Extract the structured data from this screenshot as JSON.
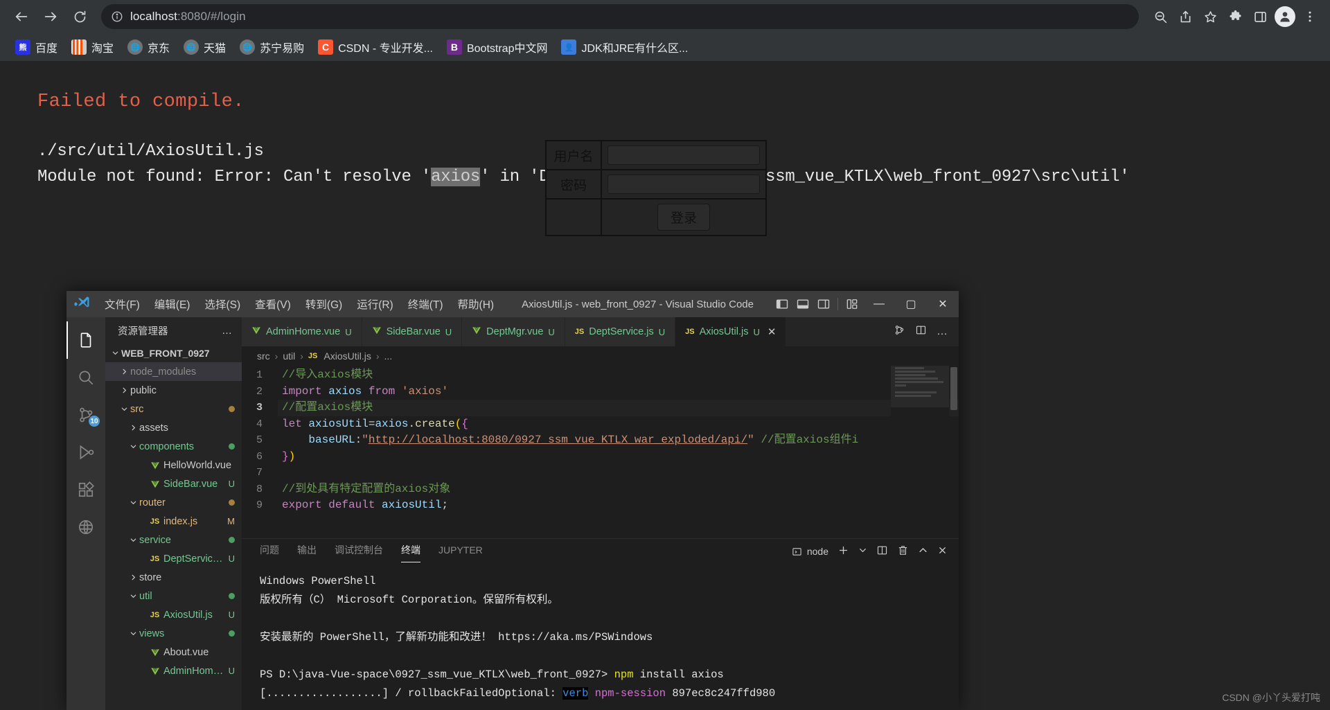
{
  "browser": {
    "back_label": "Back",
    "forward_label": "Forward",
    "reload_label": "Reload",
    "url_host": "localhost",
    "url_rest": ":8080/#/login",
    "url_full": "localhost:8080/#/login",
    "icons": {
      "info": "info-circle-icon",
      "zoom": "zoom-search-icon",
      "share": "share-icon",
      "star": "bookmark-star-icon",
      "extensions": "puzzle-extensions-icon",
      "sidepanel": "side-panel-icon",
      "profile": "profile-avatar-icon",
      "menu": "three-dot-menu-icon"
    },
    "bookmarks": [
      {
        "label": "百度",
        "icon": "baidu-icon"
      },
      {
        "label": "淘宝",
        "icon": "taobao-icon"
      },
      {
        "label": "京东",
        "icon": "jd-globe-icon"
      },
      {
        "label": "天猫",
        "icon": "tmall-globe-icon"
      },
      {
        "label": "苏宁易购",
        "icon": "suning-globe-icon"
      },
      {
        "label": "CSDN - 专业开发...",
        "icon": "csdn-icon"
      },
      {
        "label": "Bootstrap中文网",
        "icon": "bootstrap-icon"
      },
      {
        "label": "JDK和JRE有什么区...",
        "icon": "jdk-article-icon"
      }
    ]
  },
  "error_overlay": {
    "title": "Failed to compile.",
    "file": "./src/util/AxiosUtil.js",
    "message_before": "Module not found: Error: Can't resolve '",
    "highlight": "axios",
    "message_after": "' in 'D:\\java-Vue-space\\0927_ssm_vue_KTLX\\web_front_0927\\src\\util'",
    "title_color": "#e36049",
    "text_color": "#e8e8e8",
    "bg_color": "#242424"
  },
  "login_form": {
    "username_label": "用户名",
    "password_label": "密码",
    "username_value": "",
    "password_value": "",
    "submit_label": "登录"
  },
  "vscode": {
    "title": "AxiosUtil.js - web_front_0927 - Visual Studio Code",
    "menu": [
      "文件(F)",
      "编辑(E)",
      "选择(S)",
      "查看(V)",
      "转到(G)",
      "运行(R)",
      "终端(T)",
      "帮助(H)"
    ],
    "window_controls": {
      "minimize": "—",
      "maximize": "▢",
      "close": "✕"
    },
    "layout_icons": [
      "toggle-primary-sidebar-icon",
      "toggle-panel-icon",
      "toggle-secondary-sidebar-icon",
      "customize-layout-icon"
    ],
    "activity_bar": [
      {
        "name": "explorer",
        "icon": "files-explorer-icon",
        "active": true,
        "badge": ""
      },
      {
        "name": "search",
        "icon": "search-magnifier-icon",
        "active": false,
        "badge": ""
      },
      {
        "name": "source-control",
        "icon": "source-control-branch-icon",
        "active": false,
        "badge": "10"
      },
      {
        "name": "run-debug",
        "icon": "run-and-debug-icon",
        "active": false,
        "badge": ""
      },
      {
        "name": "extensions",
        "icon": "extensions-blocks-icon",
        "active": false,
        "badge": ""
      },
      {
        "name": "remote",
        "icon": "remote-explorer-icon",
        "active": false,
        "badge": ""
      }
    ],
    "explorer": {
      "title": "资源管理器",
      "more_label": "…",
      "root": "WEB_FRONT_0927",
      "tree": [
        {
          "label": "node_modules",
          "indent": 1,
          "kind": "folder",
          "state": "collapsed",
          "color": "#8c8c8c",
          "badge": "",
          "dot": "",
          "selected": true
        },
        {
          "label": "public",
          "indent": 1,
          "kind": "folder",
          "state": "collapsed",
          "color": "#cccccc",
          "badge": "",
          "dot": "",
          "selected": false
        },
        {
          "label": "src",
          "indent": 1,
          "kind": "folder",
          "state": "expanded",
          "color": "#e2b979",
          "badge": "",
          "dot": "#a5813f",
          "selected": false
        },
        {
          "label": "assets",
          "indent": 2,
          "kind": "folder",
          "state": "collapsed",
          "color": "#cccccc",
          "badge": "",
          "dot": "",
          "selected": false
        },
        {
          "label": "components",
          "indent": 2,
          "kind": "folder",
          "state": "expanded",
          "color": "#73c991",
          "badge": "",
          "dot": "#4c9e63",
          "selected": false
        },
        {
          "label": "HelloWorld.vue",
          "indent": 3,
          "kind": "vue",
          "state": "file",
          "color": "#cccccc",
          "badge": "",
          "dot": "",
          "selected": false
        },
        {
          "label": "SideBar.vue",
          "indent": 3,
          "kind": "vue",
          "state": "file",
          "color": "#73c991",
          "badge": "U",
          "dot": "",
          "selected": false
        },
        {
          "label": "router",
          "indent": 2,
          "kind": "folder",
          "state": "expanded",
          "color": "#e2b979",
          "badge": "",
          "dot": "#a5813f",
          "selected": false
        },
        {
          "label": "index.js",
          "indent": 3,
          "kind": "js",
          "state": "file",
          "color": "#e2b979",
          "badge": "M",
          "dot": "",
          "selected": false
        },
        {
          "label": "service",
          "indent": 2,
          "kind": "folder",
          "state": "expanded",
          "color": "#73c991",
          "badge": "",
          "dot": "#4c9e63",
          "selected": false
        },
        {
          "label": "DeptService.js",
          "indent": 3,
          "kind": "js",
          "state": "file",
          "color": "#73c991",
          "badge": "U",
          "dot": "",
          "selected": false
        },
        {
          "label": "store",
          "indent": 2,
          "kind": "folder",
          "state": "collapsed",
          "color": "#cccccc",
          "badge": "",
          "dot": "",
          "selected": false
        },
        {
          "label": "util",
          "indent": 2,
          "kind": "folder",
          "state": "expanded",
          "color": "#73c991",
          "badge": "",
          "dot": "#4c9e63",
          "selected": false
        },
        {
          "label": "AxiosUtil.js",
          "indent": 3,
          "kind": "js",
          "state": "file",
          "color": "#73c991",
          "badge": "U",
          "dot": "",
          "selected": false
        },
        {
          "label": "views",
          "indent": 2,
          "kind": "folder",
          "state": "expanded",
          "color": "#73c991",
          "badge": "",
          "dot": "#4c9e63",
          "selected": false
        },
        {
          "label": "About.vue",
          "indent": 3,
          "kind": "vue",
          "state": "file",
          "color": "#cccccc",
          "badge": "",
          "dot": "",
          "selected": false
        },
        {
          "label": "AdminHome.vue",
          "indent": 3,
          "kind": "vue",
          "state": "file",
          "color": "#73c991",
          "badge": "U",
          "dot": "",
          "selected": false
        }
      ]
    },
    "tabs": [
      {
        "name": "AdminHome.vue",
        "kind": "vue",
        "badge": "U",
        "active": false
      },
      {
        "name": "SideBar.vue",
        "kind": "vue",
        "badge": "U",
        "active": false
      },
      {
        "name": "DeptMgr.vue",
        "kind": "vue",
        "badge": "U",
        "active": false
      },
      {
        "name": "DeptService.js",
        "kind": "js",
        "badge": "U",
        "active": false
      },
      {
        "name": "AxiosUtil.js",
        "kind": "js",
        "badge": "U",
        "active": true
      }
    ],
    "tab_actions": [
      "split-editor-compare-icon",
      "split-editor-right-icon",
      "more-actions-icon"
    ],
    "breadcrumb": [
      "src",
      "util",
      "AxiosUtil.js",
      "..."
    ],
    "code_lines": [
      {
        "n": "1",
        "current": false,
        "tokens": [
          {
            "t": "//导入axios模块",
            "c": "c-com"
          }
        ]
      },
      {
        "n": "2",
        "current": false,
        "tokens": [
          {
            "t": "import",
            "c": "c-kw"
          },
          {
            "t": " ",
            "c": "c-op"
          },
          {
            "t": "axios",
            "c": "c-var"
          },
          {
            "t": " ",
            "c": "c-op"
          },
          {
            "t": "from",
            "c": "c-kw"
          },
          {
            "t": " ",
            "c": "c-op"
          },
          {
            "t": "'axios'",
            "c": "c-str"
          }
        ]
      },
      {
        "n": "3",
        "current": true,
        "tokens": [
          {
            "t": "//配置axios模块",
            "c": "c-com"
          }
        ]
      },
      {
        "n": "4",
        "current": false,
        "tokens": [
          {
            "t": "let",
            "c": "c-kw"
          },
          {
            "t": " ",
            "c": "c-op"
          },
          {
            "t": "axiosUtil",
            "c": "c-var"
          },
          {
            "t": "=",
            "c": "c-op"
          },
          {
            "t": "axios",
            "c": "c-var"
          },
          {
            "t": ".",
            "c": "c-op"
          },
          {
            "t": "create",
            "c": "c-fn"
          },
          {
            "t": "(",
            "c": "c-brace"
          },
          {
            "t": "{",
            "c": "c-brace2"
          }
        ]
      },
      {
        "n": "5",
        "current": false,
        "tokens": [
          {
            "t": "    ",
            "c": "c-op"
          },
          {
            "t": "baseURL",
            "c": "c-var"
          },
          {
            "t": ":",
            "c": "c-op"
          },
          {
            "t": "\"",
            "c": "c-str"
          },
          {
            "t": "http://localhost:8080/0927_ssm_vue_KTLX_war_exploded/api/",
            "c": "c-link"
          },
          {
            "t": "\"",
            "c": "c-str"
          },
          {
            "t": " ",
            "c": "c-op"
          },
          {
            "t": "//配置axios组件i",
            "c": "c-com"
          }
        ]
      },
      {
        "n": "6",
        "current": false,
        "tokens": [
          {
            "t": "}",
            "c": "c-brace2"
          },
          {
            "t": ")",
            "c": "c-brace"
          }
        ]
      },
      {
        "n": "7",
        "current": false,
        "tokens": []
      },
      {
        "n": "8",
        "current": false,
        "tokens": [
          {
            "t": "//到处具有特定配置的axios对象",
            "c": "c-com"
          }
        ]
      },
      {
        "n": "9",
        "current": false,
        "tokens": [
          {
            "t": "export",
            "c": "c-kw"
          },
          {
            "t": " ",
            "c": "c-op"
          },
          {
            "t": "default",
            "c": "c-kw"
          },
          {
            "t": " ",
            "c": "c-op"
          },
          {
            "t": "axiosUtil",
            "c": "c-var"
          },
          {
            "t": ";",
            "c": "c-op"
          }
        ]
      }
    ],
    "panel": {
      "tabs": [
        "问题",
        "输出",
        "调试控制台",
        "终端",
        "JUPYTER"
      ],
      "active_tab": "终端",
      "shell_label": "node",
      "actions": [
        "new-terminal-icon",
        "chevron-down-icon",
        "split-terminal-icon",
        "kill-terminal-trash-icon",
        "maximize-panel-icon",
        "close-panel-icon"
      ],
      "terminal_lines": [
        [
          {
            "t": "Windows PowerShell",
            "c": "t-white"
          }
        ],
        [
          {
            "t": "版权所有（C） Microsoft Corporation。保留所有权利。",
            "c": "t-white"
          }
        ],
        [
          {
            "t": "",
            "c": "t-white"
          }
        ],
        [
          {
            "t": "安装最新的 PowerShell，了解新功能和改进！ https://aka.ms/PSWindows",
            "c": "t-white"
          }
        ],
        [
          {
            "t": "",
            "c": "t-white"
          }
        ],
        [
          {
            "t": "PS D:\\java-Vue-space\\0927_ssm_vue_KTLX\\web_front_0927> ",
            "c": "t-white"
          },
          {
            "t": "npm",
            "c": "t-yellow"
          },
          {
            "t": " install axios",
            "c": "t-white"
          }
        ],
        [
          {
            "t": "[..................] / rollbackFailedOptional: ",
            "c": "t-white"
          },
          {
            "t": "verb",
            "c": "t-blueinv"
          },
          {
            "t": " ",
            "c": "t-white"
          },
          {
            "t": "npm-session",
            "c": "t-magenta"
          },
          {
            "t": " 897ec8c247ffd980",
            "c": "t-white"
          }
        ]
      ]
    }
  },
  "watermark": "CSDN @小丫头爱打吨"
}
